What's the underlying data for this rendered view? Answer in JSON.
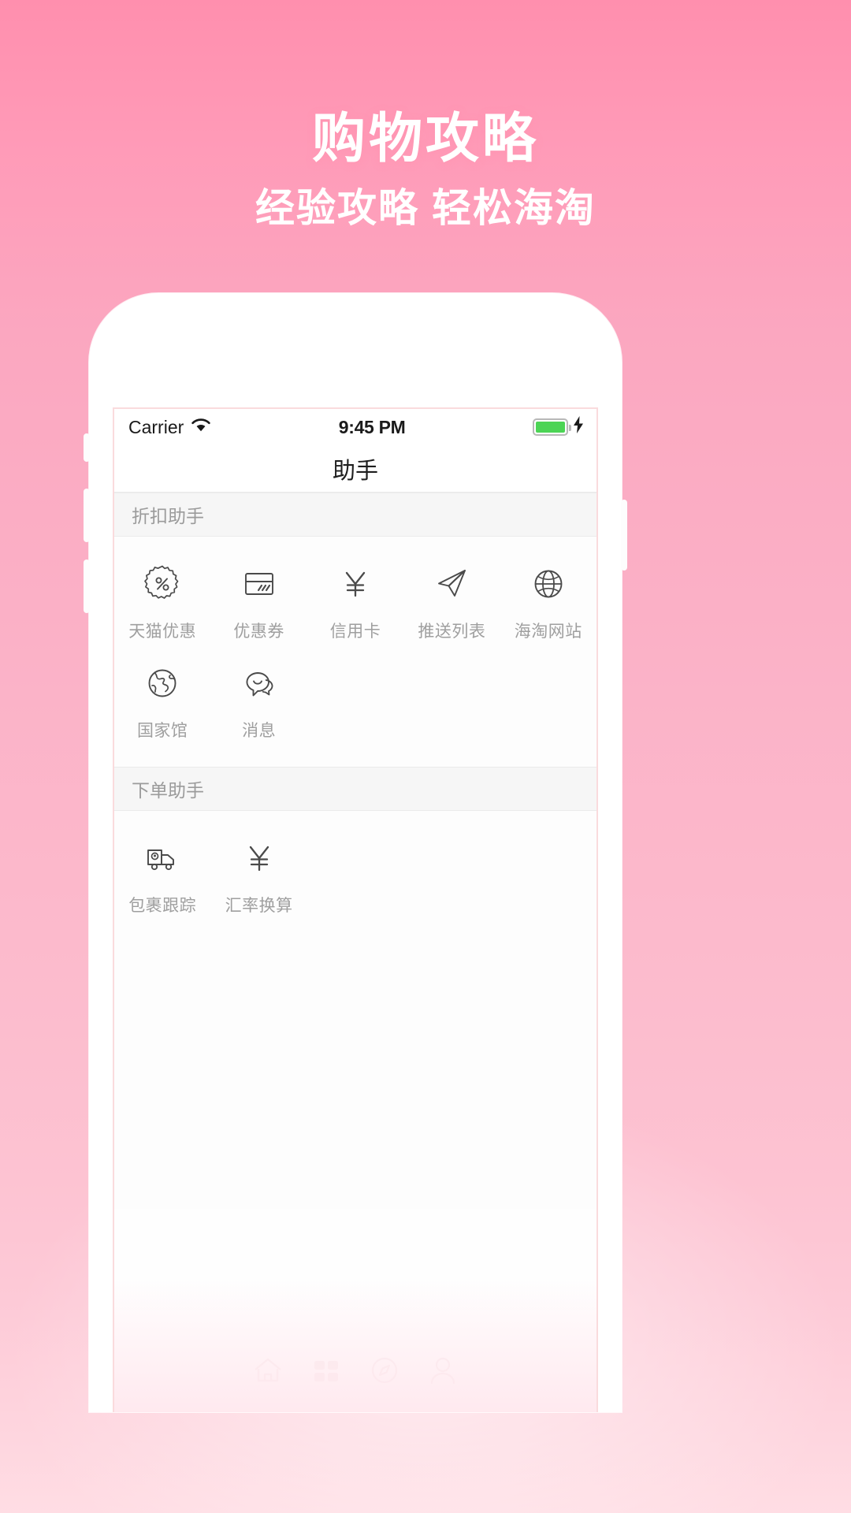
{
  "promo": {
    "title": "购物攻略",
    "subtitle": "经验攻略 轻松海淘",
    "title_color": "#ffffff",
    "background_top_color": "#ff8fae",
    "background_bottom_color": "#ffdde4"
  },
  "phone": {
    "status_bar": {
      "carrier": "Carrier",
      "wifi_icon": "wifi-icon",
      "time": "9:45 PM",
      "battery_icon": "battery-full-icon",
      "battery_color": "#4cd455",
      "charging_icon": "lightning-bolt-icon"
    },
    "nav_bar": {
      "title": "助手"
    },
    "sections": [
      {
        "header": "折扣助手",
        "items": [
          {
            "label": "天猫优惠",
            "icon": "discount-badge-icon"
          },
          {
            "label": "优惠券",
            "icon": "coupon-card-icon"
          },
          {
            "label": "信用卡",
            "icon": "yen-credit-icon"
          },
          {
            "label": "推送列表",
            "icon": "paper-plane-icon"
          },
          {
            "label": "海淘网站",
            "icon": "globe-grid-icon"
          },
          {
            "label": "国家馆",
            "icon": "globe-earth-icon"
          },
          {
            "label": "消息",
            "icon": "chat-bubbles-icon"
          }
        ]
      },
      {
        "header": "下单助手",
        "items": [
          {
            "label": "包裹跟踪",
            "icon": "delivery-truck-icon"
          },
          {
            "label": "汇率换算",
            "icon": "yen-exchange-icon"
          }
        ]
      }
    ],
    "tab_bar": [
      {
        "icon": "home-icon"
      },
      {
        "icon": "grid-apps-icon"
      },
      {
        "icon": "compass-icon"
      },
      {
        "icon": "person-icon"
      }
    ]
  }
}
